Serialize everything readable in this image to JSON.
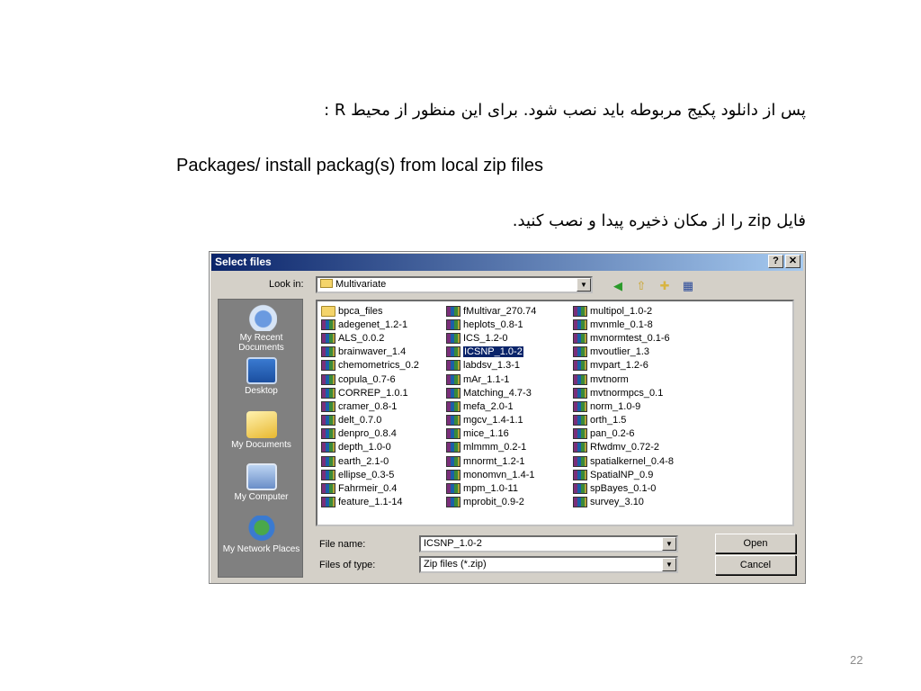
{
  "slide": {
    "line1": "پس از دانلود پکیج مربوطه باید نصب شود. برای این منظور از محیط R :",
    "line2": "Packages/ install packag(s) from local zip files",
    "line3": "فایل zip را از مکان ذخیره پیدا و نصب کنید.",
    "page_number": "22"
  },
  "dialog": {
    "title": "Select files",
    "help_button": "?",
    "close_button": "✕",
    "look_in_label": "Look in:",
    "look_in_value": "Multivariate",
    "toolbar_icons": [
      "back-icon",
      "up-folder-icon",
      "new-folder-icon",
      "view-menu-icon"
    ],
    "places": [
      {
        "label": "My Recent Documents",
        "icon": "recent-documents-icon"
      },
      {
        "label": "Desktop",
        "icon": "desktop-icon"
      },
      {
        "label": "My Documents",
        "icon": "my-documents-icon"
      },
      {
        "label": "My Computer",
        "icon": "my-computer-icon"
      },
      {
        "label": "My Network Places",
        "icon": "network-places-icon"
      }
    ],
    "files": {
      "col1": [
        "bpca_files",
        "adegenet_1.2-1",
        "ALS_0.0.2",
        "brainwaver_1.4",
        "chemometrics_0.2",
        "copula_0.7-6",
        "CORREP_1.0.1",
        "cramer_0.8-1",
        "delt_0.7.0",
        "denpro_0.8.4",
        "depth_1.0-0",
        "earth_2.1-0",
        "ellipse_0.3-5",
        "Fahrmeir_0.4",
        "feature_1.1-14"
      ],
      "col2": [
        "fMultivar_270.74",
        "heplots_0.8-1",
        "ICS_1.2-0",
        "ICSNP_1.0-2",
        "labdsv_1.3-1",
        "mAr_1.1-1",
        "Matching_4.7-3",
        "mefa_2.0-1",
        "mgcv_1.4-1.1",
        "mice_1.16",
        "mlmmm_0.2-1",
        "mnormt_1.2-1",
        "monomvn_1.4-1",
        "mpm_1.0-11",
        "mprobit_0.9-2"
      ],
      "col3": [
        "multipol_1.0-2",
        "mvnmle_0.1-8",
        "mvnormtest_0.1-6",
        "mvoutlier_1.3",
        "mvpart_1.2-6",
        "mvtnorm",
        "mvtnormpcs_0.1",
        "norm_1.0-9",
        "orth_1.5",
        "pan_0.2-6",
        "Rfwdmv_0.72-2",
        "spatialkernel_0.4-8",
        "SpatialNP_0.9",
        "spBayes_0.1-0",
        "survey_3.10"
      ],
      "selected": "ICSNP_1.0-2"
    },
    "file_name_label": "File name:",
    "file_name_value": "ICSNP_1.0-2",
    "file_type_label": "Files of type:",
    "file_type_value": "Zip files (*.zip)",
    "open_button": "Open",
    "cancel_button": "Cancel"
  }
}
